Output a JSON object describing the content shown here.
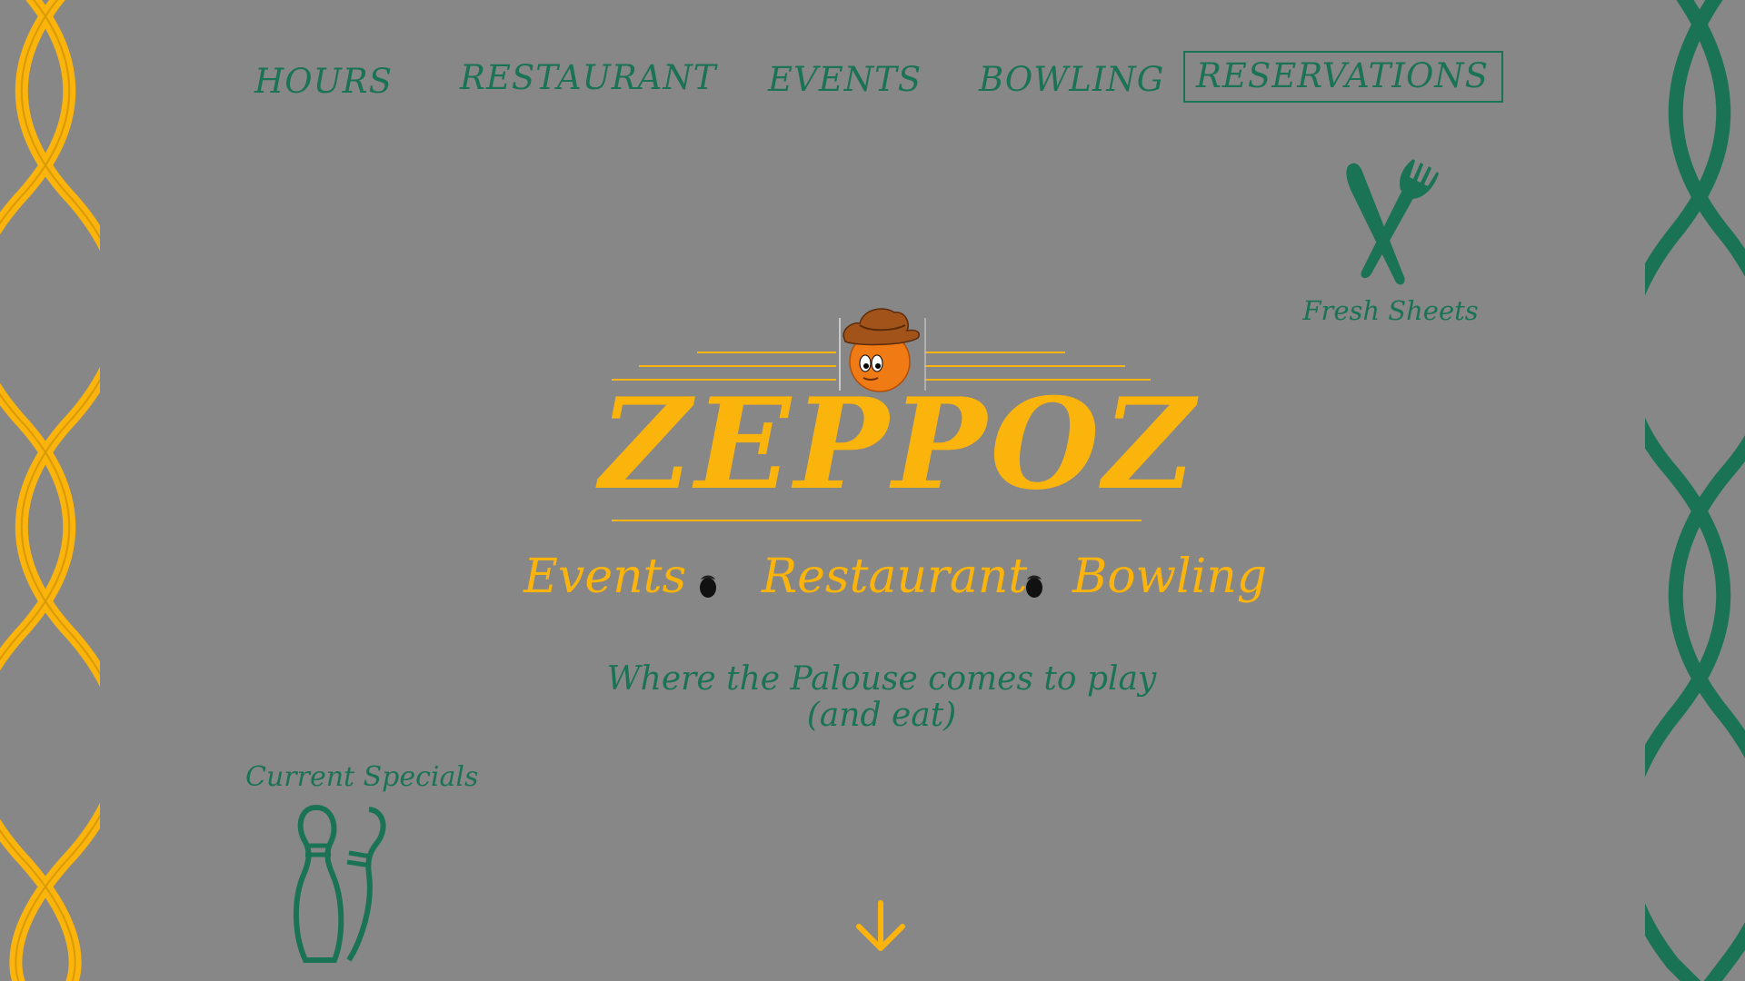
{
  "nav": {
    "items": [
      {
        "label": "HOURS"
      },
      {
        "label": "RESTAURANT"
      },
      {
        "label": "EVENTS"
      },
      {
        "label": "BOWLING"
      },
      {
        "label": "RESERVATIONS"
      }
    ]
  },
  "fresh_sheets": {
    "label": "Fresh Sheets",
    "icon": "fork-knife-icon"
  },
  "logo": {
    "wordmark": "ZEPPOZ",
    "mascot": "bowling-ball-cowboy-mascot"
  },
  "subtitle": {
    "events": "Events",
    "restaurant": "Restaurant",
    "bowling": "Bowling"
  },
  "tagline": {
    "line1": "Where the Palouse comes to play",
    "line2": "(and eat)"
  },
  "specials": {
    "label": "Current Specials",
    "icon": "bowling-pins-icon"
  },
  "scroll": {
    "icon": "arrow-down-icon"
  },
  "colors": {
    "background": "#878787",
    "gold": "#fbb40c",
    "green": "#1b7355",
    "mascot_orange": "#f07a14",
    "hat_brown": "#a2531a"
  }
}
